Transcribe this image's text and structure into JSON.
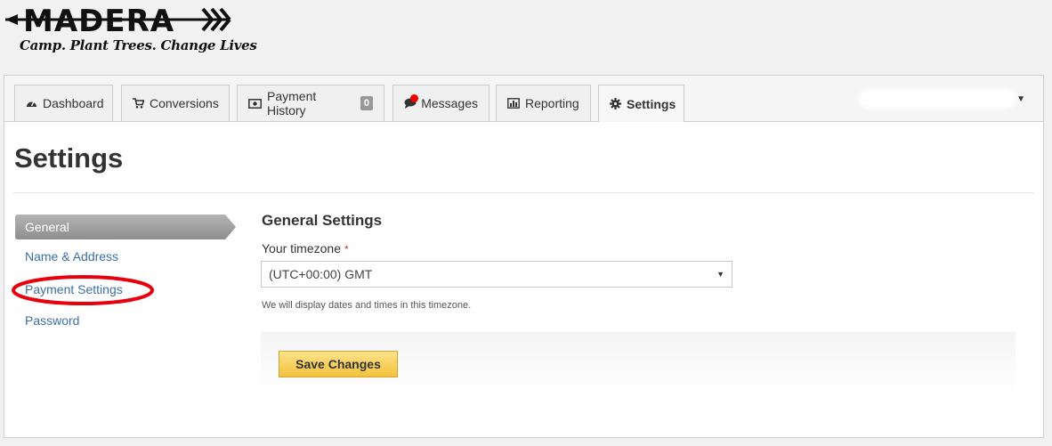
{
  "brand": {
    "logo_text": "MADERA",
    "tagline": "Camp. Plant Trees. Change Lives"
  },
  "tabs": [
    {
      "label": "Dashboard",
      "icon": "dashboard-icon"
    },
    {
      "label": "Conversions",
      "icon": "cart-icon"
    },
    {
      "label": "Payment History",
      "icon": "money-icon",
      "badge": "0"
    },
    {
      "label": "Messages",
      "icon": "comment-icon",
      "notification": true
    },
    {
      "label": "Reporting",
      "icon": "bar-chart-icon"
    },
    {
      "label": "Settings",
      "icon": "gear-icon",
      "active": true
    }
  ],
  "user_menu": {
    "label": "",
    "icon": "caret-down-icon"
  },
  "page": {
    "title": "Settings"
  },
  "sidebar": {
    "items": [
      {
        "label": "General",
        "active": true
      },
      {
        "label": "Name & Address"
      },
      {
        "label": "Payment Settings",
        "highlighted": true
      },
      {
        "label": "Password"
      }
    ]
  },
  "form": {
    "section_title": "General Settings",
    "timezone_label": "Your timezone",
    "required_mark": "*",
    "timezone_value": "(UTC+00:00) GMT",
    "timezone_help": "We will display dates and times in this timezone.",
    "save_label": "Save Changes"
  },
  "colors": {
    "link": "#3b6fa8",
    "active_sidebar": "#9a9a9a",
    "save_button": "#f5c94f",
    "annotation": "#e8000d",
    "notification_dot": "#ee0000"
  }
}
